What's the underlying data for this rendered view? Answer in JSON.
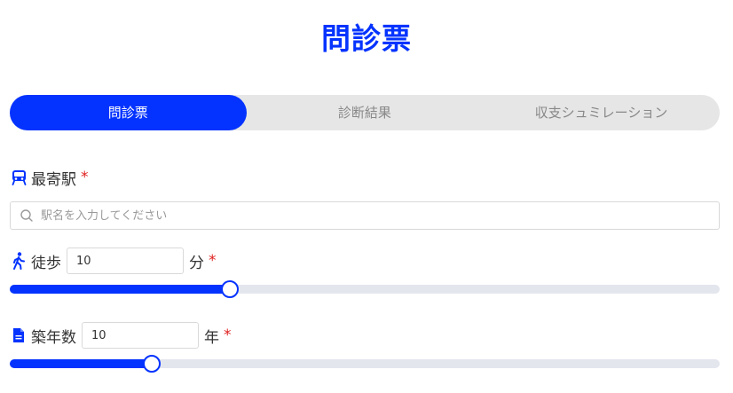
{
  "page": {
    "title": "問診票"
  },
  "tabs": [
    {
      "label": "問診票",
      "active": true
    },
    {
      "label": "診断結果",
      "active": false
    },
    {
      "label": "収支シュミレーション",
      "active": false
    }
  ],
  "station": {
    "icon": "train-icon",
    "label": "最寄駅",
    "required_mark": "*",
    "search_icon": "search-icon",
    "placeholder": "駅名を入力してください",
    "value": ""
  },
  "walk": {
    "icon": "walking-icon",
    "label": "徒歩",
    "value": "10",
    "unit": "分",
    "required_mark": "*",
    "slider_level": 0.31
  },
  "building_age": {
    "icon": "document-icon",
    "label": "築年数",
    "value": "10",
    "unit": "年",
    "required_mark": "*",
    "slider_level": 0.2
  },
  "colors": {
    "accent": "#0433ff",
    "required": "#e02020",
    "track": "#e4e6ee",
    "tab_bg": "#e6e6e6"
  }
}
